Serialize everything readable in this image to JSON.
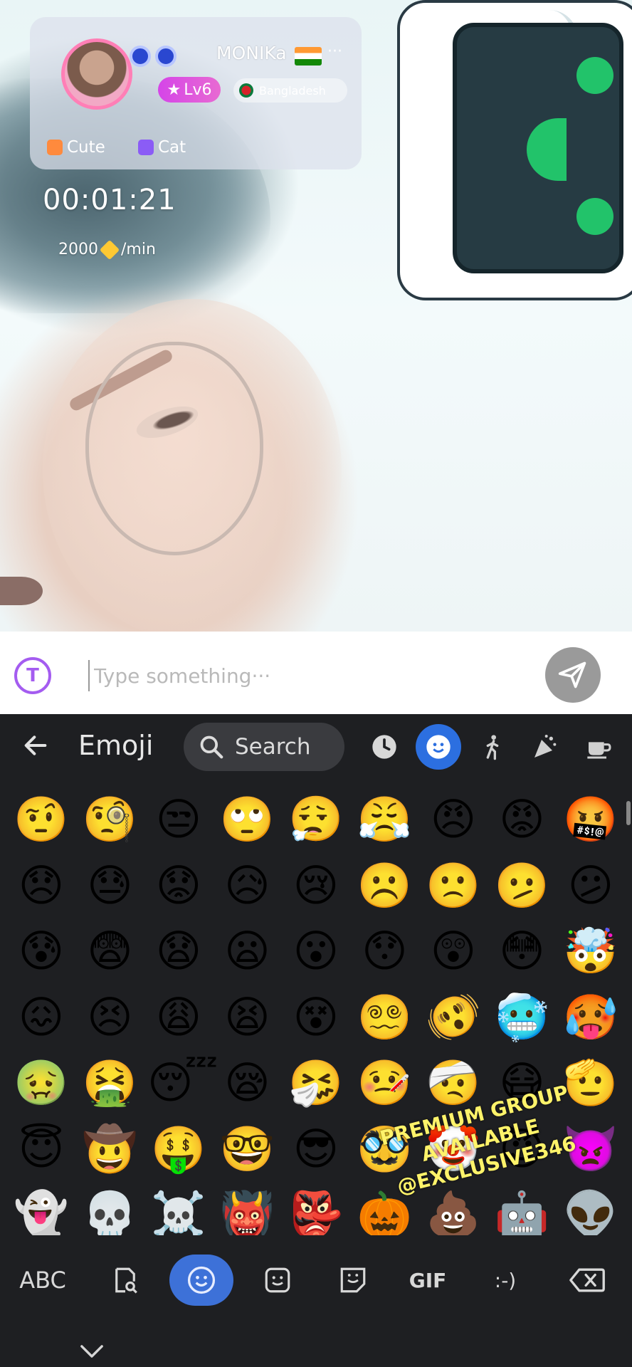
{
  "profile": {
    "name": "MONIKa",
    "more": "···",
    "level": "Lv6",
    "country": "Bangladesh",
    "tags": [
      {
        "label": "Cute",
        "color": "#ff8a3d"
      },
      {
        "label": "Cat",
        "color": "#8b5cf6"
      }
    ]
  },
  "call": {
    "timer": "00:01:21",
    "rate_value": "2000",
    "rate_unit": "/min"
  },
  "input": {
    "placeholder": "Type something···",
    "logo_letter": "T"
  },
  "keyboard": {
    "title": "Emoji",
    "search_label": "Search",
    "categories": [
      "recent-icon",
      "smiley-icon",
      "person-walking-icon",
      "party-icon",
      "coffee-icon"
    ],
    "active_category": "smiley-icon",
    "bottom_keys": {
      "abc": "ABC",
      "gif": "GIF",
      "emoticon": ":-)"
    },
    "rows": [
      [
        "🤨",
        "🧐",
        "😒",
        "🙄",
        "😮‍💨",
        "😤",
        "😠",
        "😡",
        "🤬"
      ],
      [
        "😞",
        "😓",
        "😟",
        "😥",
        "😢",
        "☹️",
        "🙁",
        "🫤",
        "😕"
      ],
      [
        "😰",
        "😨",
        "😧",
        "😦",
        "😮",
        "😯",
        "😲",
        "😳",
        "🤯"
      ],
      [
        "😖",
        "😣",
        "😩",
        "😫",
        "😵",
        "😵‍💫",
        "🫨",
        "🥶",
        "🥵"
      ],
      [
        "🤢",
        "🤮",
        "😴",
        "😪",
        "🤧",
        "🤒",
        "🤕",
        "😷",
        "🫡"
      ],
      [
        "😇",
        "🤠",
        "🤑",
        "🤓",
        "😎",
        "🥸",
        "🤡",
        "😈",
        "👿"
      ],
      [
        "👻",
        "💀",
        "☠️",
        "👹",
        "👺",
        "🎃",
        "💩",
        "🤖",
        "👽"
      ]
    ]
  },
  "watermark": {
    "line1": "PREMIUM GROUP",
    "line2": "AVAILABLE",
    "line3": "@EXCLUSIVE346"
  },
  "colors": {
    "keyboard_bg": "#1e1f22",
    "accent": "#3d71d8",
    "level_badge": "#d545e8",
    "logo": "#a45cf0"
  }
}
